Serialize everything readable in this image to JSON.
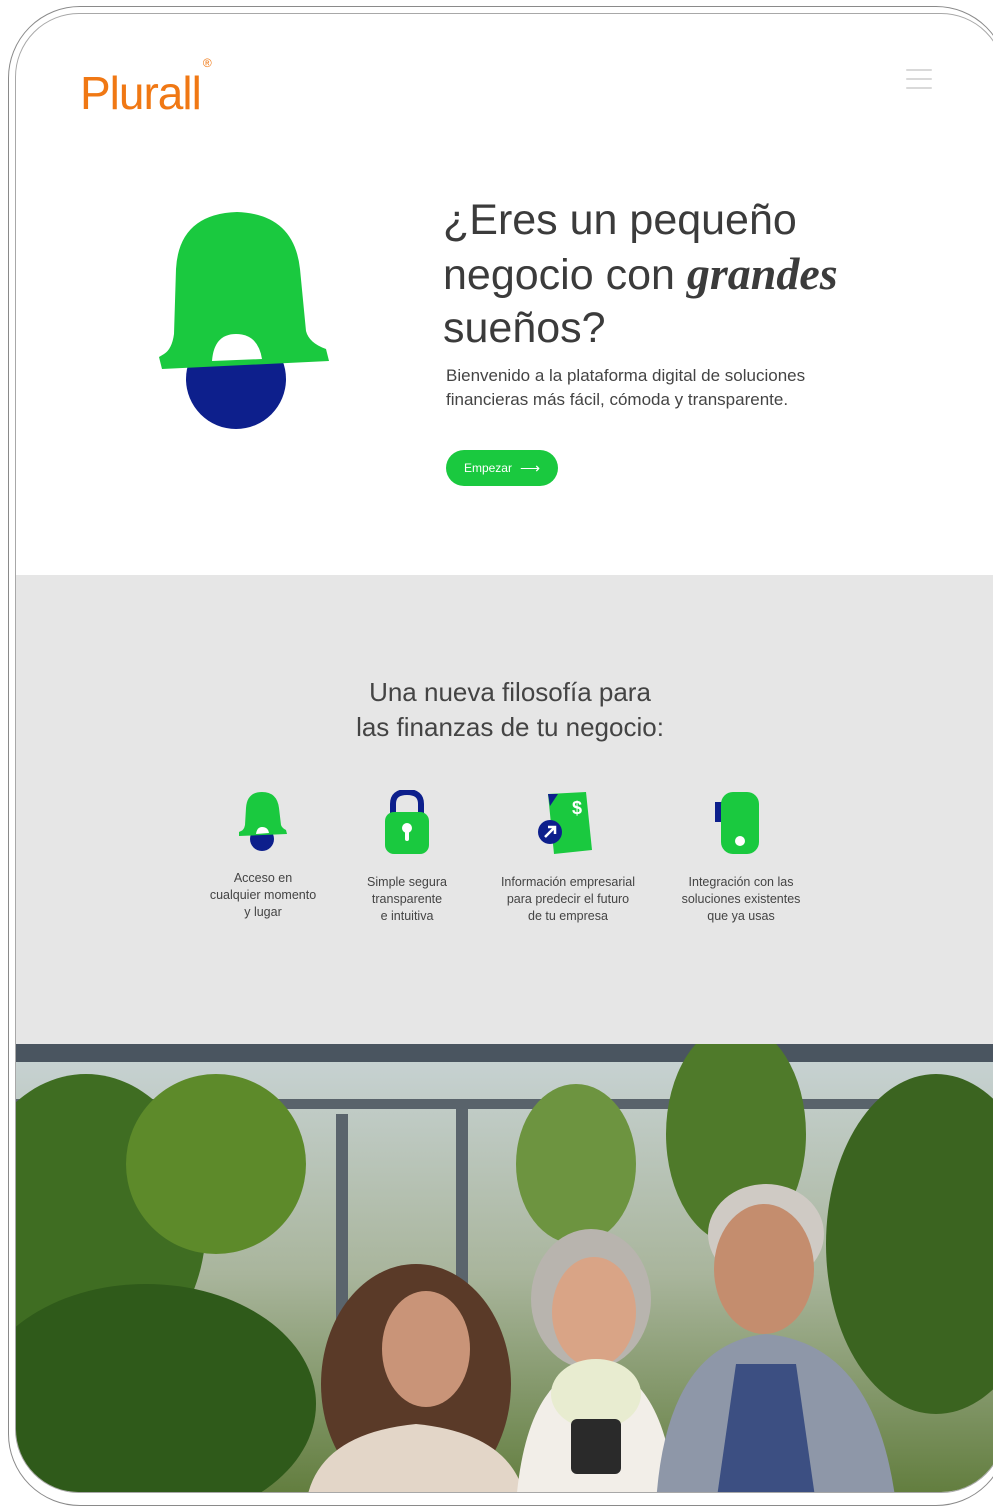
{
  "brand": {
    "name": "Plurall",
    "mark": "®",
    "color": "#f07814"
  },
  "header": {
    "menu_icon": "hamburger-menu-icon"
  },
  "hero": {
    "title_prefix": "¿Eres un pequeño negocio con ",
    "title_emphasis": "grandes",
    "title_suffix": " sueños?",
    "subtitle": "Bienvenido a la plataforma digital de soluciones financieras más fácil, cómoda y transparente.",
    "cta_label": "Empezar",
    "cta_icon": "arrow-right-icon",
    "illustration": "bell-icon"
  },
  "philosophy": {
    "title_line1": "Una nueva filosofía para",
    "title_line2": "las finanzas de tu negocio:",
    "features": [
      {
        "icon": "bell-icon",
        "text": "Acceso en\ncualquier momento\ny lugar"
      },
      {
        "icon": "padlock-icon",
        "text": "Simple segura\ntransparente\ne intuitiva"
      },
      {
        "icon": "document-dollar-icon",
        "text": "Información empresarial\npara predecir el futuro\nde tu empresa"
      },
      {
        "icon": "phone-integration-icon",
        "text": "Integración con las\nsoluciones existentes\nque ya usas"
      }
    ]
  },
  "colors": {
    "accent_green": "#1ac93f",
    "accent_blue": "#0d1f8c",
    "section_gray": "#e6e6e6"
  },
  "photo": {
    "subject": "greenhouse-photo"
  }
}
